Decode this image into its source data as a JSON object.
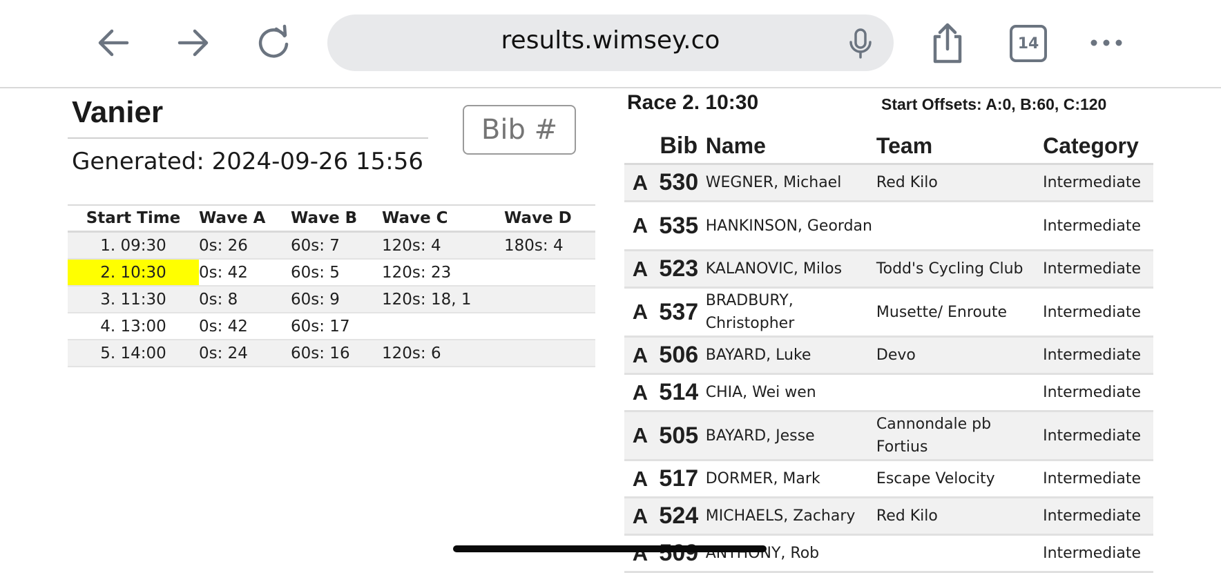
{
  "browser": {
    "url": "results.wimsey.co",
    "tab_count": "14",
    "icons": [
      "back-arrow-icon",
      "forward-arrow-icon",
      "reload-icon",
      "microphone-icon",
      "share-icon",
      "tabs-icon",
      "more-icon"
    ]
  },
  "left": {
    "venue": "Vanier",
    "generated": "Generated: 2024-09-26 15:56",
    "bib_placeholder": "Bib #",
    "table": {
      "headers": [
        "Start Time",
        "Wave A",
        "Wave B",
        "Wave C",
        "Wave D"
      ],
      "rows": [
        [
          "1. 09:30",
          "0s: 26",
          "60s: 7",
          "120s: 4",
          "180s: 4"
        ],
        [
          "2. 10:30",
          "0s: 42",
          "60s: 5",
          "120s: 23",
          ""
        ],
        [
          "3. 11:30",
          "0s: 8",
          "60s: 9",
          "120s: 18, 1",
          ""
        ],
        [
          "4. 13:00",
          "0s: 42",
          "60s: 17",
          "",
          ""
        ],
        [
          "5. 14:00",
          "0s: 24",
          "60s: 16",
          "120s: 6",
          ""
        ]
      ],
      "highlight_color": "#ffff00"
    }
  },
  "right": {
    "race_title": "Race 2. 10:30",
    "offsets": "Start Offsets: A:0, B:60, C:120",
    "headers": [
      "Bib",
      "Name",
      "Team",
      "Category"
    ],
    "riders": [
      {
        "wave": "A",
        "bib": "530",
        "name": "WEGNER, Michael",
        "team": "Red Kilo",
        "category": "Intermediate"
      },
      {
        "wave": "A",
        "bib": "535",
        "name": "HANKINSON, Geordan",
        "team": "",
        "category": "Intermediate"
      },
      {
        "wave": "A",
        "bib": "523",
        "name": "KALANOVIC, Milos",
        "team": "Todd's Cycling Club",
        "category": "Intermediate"
      },
      {
        "wave": "A",
        "bib": "537",
        "name": "BRADBURY, Christopher",
        "team": "Musette/ Enroute",
        "category": "Intermediate"
      },
      {
        "wave": "A",
        "bib": "506",
        "name": "BAYARD, Luke",
        "team": "Devo",
        "category": "Intermediate"
      },
      {
        "wave": "A",
        "bib": "514",
        "name": "CHIA, Wei wen",
        "team": "",
        "category": "Intermediate"
      },
      {
        "wave": "A",
        "bib": "505",
        "name": "BAYARD, Jesse",
        "team": "Cannondale pb Fortius",
        "category": "Intermediate"
      },
      {
        "wave": "A",
        "bib": "517",
        "name": "DORMER, Mark",
        "team": "Escape Velocity",
        "category": "Intermediate"
      },
      {
        "wave": "A",
        "bib": "524",
        "name": "MICHAELS, Zachary",
        "team": "Red Kilo",
        "category": "Intermediate"
      },
      {
        "wave": "A",
        "bib": "509",
        "name": "ANTHONY, Rob",
        "team": "",
        "category": "Intermediate"
      }
    ]
  }
}
